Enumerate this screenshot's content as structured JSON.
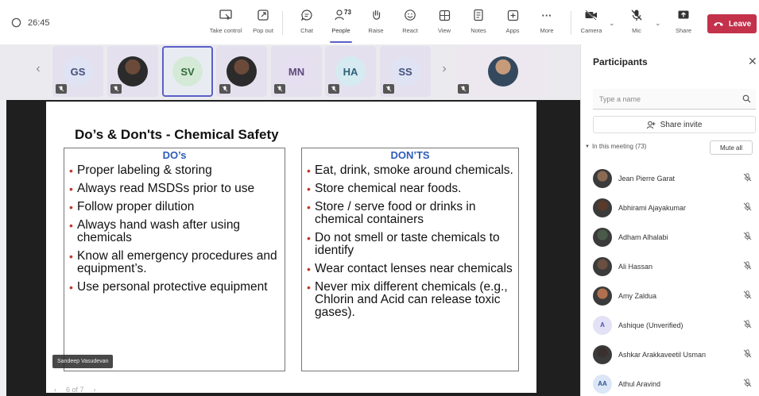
{
  "timer": "26:45",
  "toolbar": {
    "take_control": "Take control",
    "pop_out": "Pop out",
    "chat": "Chat",
    "people": "People",
    "people_count": "73",
    "raise": "Raise",
    "react": "React",
    "view": "View",
    "notes": "Notes",
    "apps": "Apps",
    "more": "More",
    "more_glyph": "···",
    "camera": "Camera",
    "mic": "Mic",
    "share": "Share",
    "leave": "Leave"
  },
  "gallery": {
    "tiles": [
      {
        "initials": "GS",
        "bg": "#dfe3f3",
        "fg": "#44507a"
      },
      {
        "initials": "",
        "photo": true
      },
      {
        "initials": "SV",
        "bg": "#d5ead6",
        "fg": "#2f6b3a",
        "selected": true
      },
      {
        "initials": "",
        "photo": true
      },
      {
        "initials": "MN",
        "bg": "#e6def1",
        "fg": "#5a4a7a"
      },
      {
        "initials": "HA",
        "bg": "#d6eaf2",
        "fg": "#2f6077"
      },
      {
        "initials": "SS",
        "bg": "#dfe3f3",
        "fg": "#44507a"
      },
      {
        "initials": "",
        "photo": true
      }
    ]
  },
  "slide": {
    "title": "Do’s & Don'ts - Chemical Safety",
    "dos_header": "DO’s",
    "donts_header": "DON’TS",
    "dos": [
      "Proper labeling & storing",
      "Always read MSDSs prior to use",
      "Follow proper dilution",
      "Always hand wash after using chemicals",
      "Know all emergency procedures and equipment’s.",
      "Use personal protective equipment"
    ],
    "donts": [
      "Eat, drink, smoke around chemicals.",
      "Store chemical near foods.",
      "Store / serve food or drinks in chemical containers",
      "Do not smell or taste chemicals to identify",
      "Wear contact lenses near chemicals",
      "Never mix different chemicals (e.g., Chlorin  and Acid can release toxic gases)."
    ]
  },
  "presenter": "Sandeep Vasudevan",
  "slide_pager": "6 of 7",
  "panel": {
    "title": "Participants",
    "search_placeholder": "Type a name",
    "share_invite": "Share invite",
    "in_meeting": "In this meeting (73)",
    "mute_all": "Mute all",
    "participants": [
      {
        "name": "Jean Pierre Garat",
        "initials": "",
        "photo": "#8a6a55"
      },
      {
        "name": "Abhirami Ajayakumar",
        "initials": "",
        "photo": "#5a3a2a"
      },
      {
        "name": "Adham Alhalabi",
        "initials": "",
        "photo": "#4a5a4a"
      },
      {
        "name": "Ali Hassan",
        "initials": "",
        "photo": "#6a5040"
      },
      {
        "name": "Amy Zaldua",
        "initials": "",
        "photo": "#b07050"
      },
      {
        "name": "Ashique (Unverified)",
        "initials": "A",
        "bg": "#e3e1f5",
        "fg": "#4f52b2"
      },
      {
        "name": "Ashkar Arakkaveetil Usman",
        "initials": "",
        "photo": "#3a3030"
      },
      {
        "name": "Athul Aravind",
        "initials": "AA",
        "bg": "#dbe6f6",
        "fg": "#2c5590"
      }
    ]
  }
}
